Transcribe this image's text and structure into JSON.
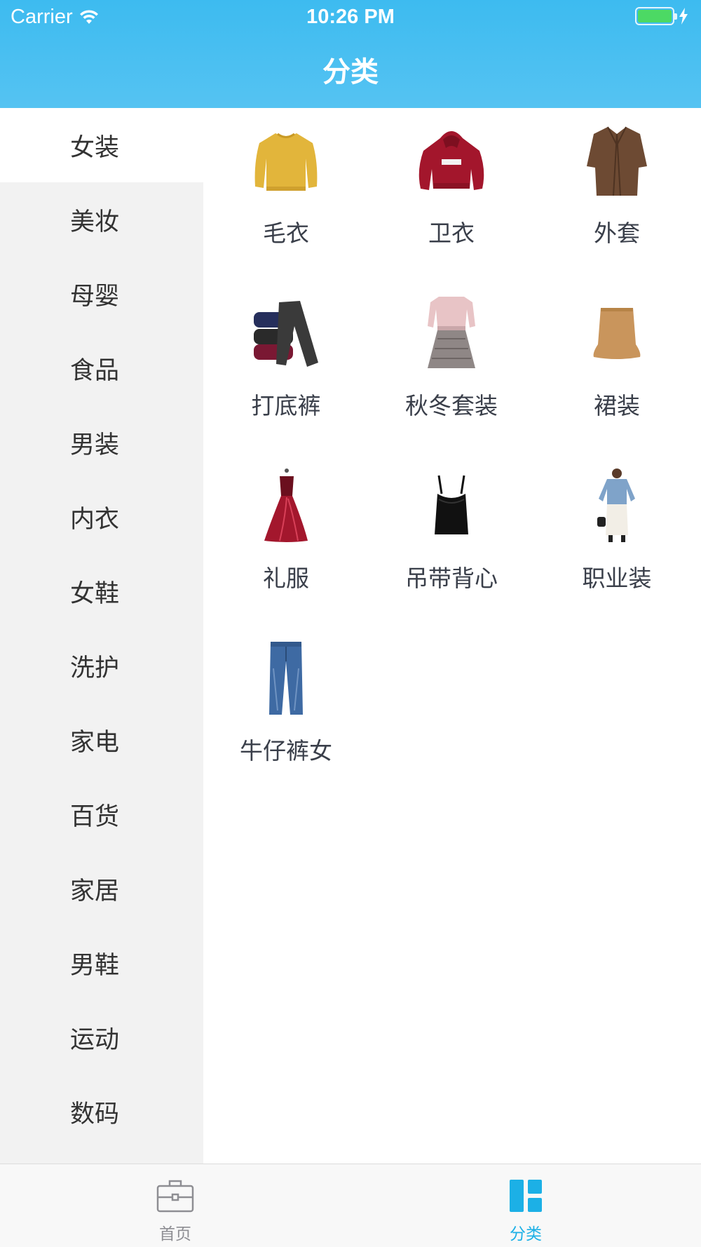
{
  "status_bar": {
    "carrier": "Carrier",
    "time": "10:26 PM",
    "battery_color": "#4cd964"
  },
  "nav": {
    "title": "分类"
  },
  "sidebar": {
    "items": [
      {
        "label": "女装",
        "active": true
      },
      {
        "label": "美妆"
      },
      {
        "label": "母婴"
      },
      {
        "label": "食品"
      },
      {
        "label": "男装"
      },
      {
        "label": "内衣"
      },
      {
        "label": "女鞋"
      },
      {
        "label": "洗护"
      },
      {
        "label": "家电"
      },
      {
        "label": "百货"
      },
      {
        "label": "家居"
      },
      {
        "label": "男鞋"
      },
      {
        "label": "运动"
      },
      {
        "label": "数码"
      }
    ]
  },
  "grid": {
    "items": [
      {
        "label": "毛衣",
        "image": "sweater"
      },
      {
        "label": "卫衣",
        "image": "hoodie"
      },
      {
        "label": "外套",
        "image": "coat"
      },
      {
        "label": "打底裤",
        "image": "leggings"
      },
      {
        "label": "秋冬套装",
        "image": "outfit-set"
      },
      {
        "label": "裙装",
        "image": "skirt"
      },
      {
        "label": "礼服",
        "image": "gown"
      },
      {
        "label": "吊带背心",
        "image": "camisole"
      },
      {
        "label": "职业装",
        "image": "office-wear"
      },
      {
        "label": "牛仔裤女",
        "image": "jeans"
      }
    ]
  },
  "tabbar": {
    "tabs": [
      {
        "label": "首页",
        "icon": "briefcase-icon",
        "active": false
      },
      {
        "label": "分类",
        "icon": "category-grid-icon",
        "active": true
      }
    ],
    "active_color": "#1cb0e6",
    "inactive_color": "#8e8e93"
  }
}
